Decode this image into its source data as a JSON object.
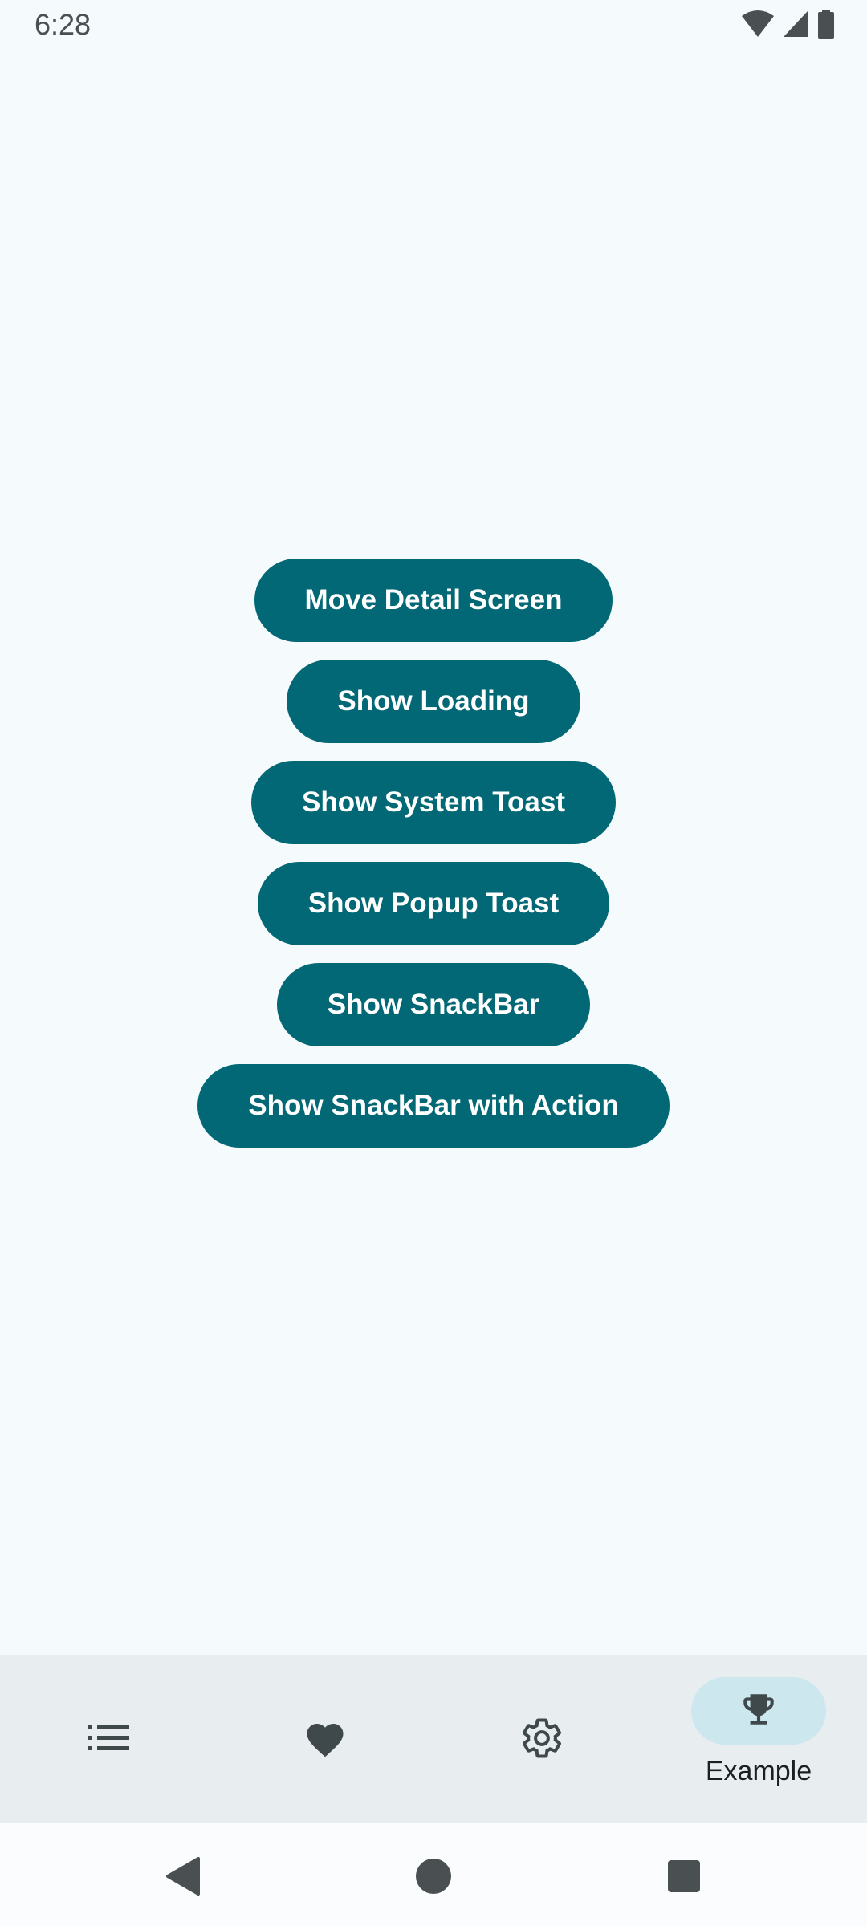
{
  "status_bar": {
    "time": "6:28",
    "icons": [
      "wifi-icon",
      "cell-signal-icon",
      "battery-icon"
    ]
  },
  "buttons": [
    {
      "label": "Move Detail Screen"
    },
    {
      "label": "Show Loading"
    },
    {
      "label": "Show System Toast"
    },
    {
      "label": "Show Popup Toast"
    },
    {
      "label": "Show SnackBar"
    },
    {
      "label": "Show SnackBar with Action"
    }
  ],
  "bottom_nav": {
    "items": [
      {
        "icon": "list-icon",
        "label": ""
      },
      {
        "icon": "heart-icon",
        "label": ""
      },
      {
        "icon": "gear-icon",
        "label": ""
      },
      {
        "icon": "trophy-icon",
        "label": "Example",
        "selected": true
      }
    ]
  },
  "system_nav": {
    "icons": [
      "back-icon",
      "home-icon",
      "recents-icon"
    ]
  },
  "colors": {
    "background": "#f5fafd",
    "button": "#026875",
    "button_text": "#ffffff",
    "nav_background": "#e8edf0",
    "nav_indicator": "#cce7ee",
    "icon": "#3f484b"
  }
}
